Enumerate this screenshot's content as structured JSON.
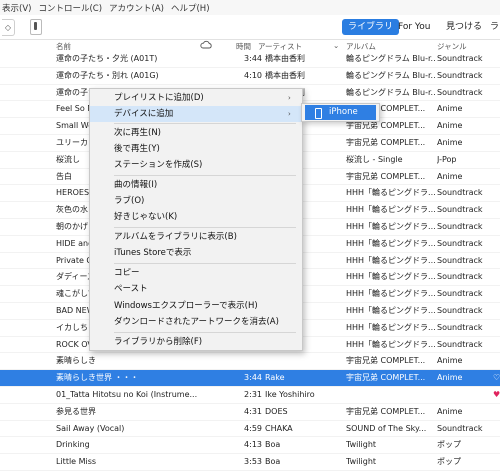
{
  "menubar": [
    "表示(V)",
    "コントロール(C)",
    "アカウント(A)",
    "ヘルプ(H)"
  ],
  "toolbar": {
    "nav_arrow": "◇",
    "tabs": [
      "ライブラリ",
      "For You",
      "見つける",
      "ラ"
    ]
  },
  "columns": {
    "name": "名前",
    "time": "時間",
    "artist": "アーティスト",
    "album": "アルバム",
    "genre": "ジャンル"
  },
  "rows": [
    {
      "name": "運命の子たち・夕光 (A01T)",
      "time": "3:44",
      "artist": "橋本由香利",
      "album": "輪るピングドラム Blu-r...",
      "genre": "Soundtrack"
    },
    {
      "name": "運命の子たち・別れ (A01G)",
      "time": "4:10",
      "artist": "橋本由香利",
      "album": "輪るピングドラム Blu-r...",
      "genre": "Soundtrack"
    },
    {
      "name": "運命の子たち",
      "time": "3:40",
      "artist": "橋本由香利",
      "album": "輪るピングドラム Blu-r...",
      "genre": "Soundtrack"
    },
    {
      "name": "Feel So M",
      "time": "",
      "artist": "",
      "album": "宇宙兄弟 COMPLET...",
      "genre": "Anime"
    },
    {
      "name": "Small Wo",
      "time": "",
      "artist": "",
      "album": "宇宙兄弟 COMPLET...",
      "genre": "Anime"
    },
    {
      "name": "ユリーカ",
      "time": "",
      "artist": "",
      "album": "宇宙兄弟 COMPLET...",
      "genre": "Anime"
    },
    {
      "name": "桜流し",
      "time": "",
      "artist": "",
      "album": "桜流し - Single",
      "genre": "J-Pop"
    },
    {
      "name": "告白",
      "time": "",
      "artist": "",
      "album": "宇宙兄弟 COMPLET...",
      "genre": "Anime"
    },
    {
      "name": "HEROES",
      "time": "",
      "artist": "",
      "album": "HHH「輪るピングドラ...",
      "genre": "Soundtrack"
    },
    {
      "name": "灰色の水",
      "time": "",
      "artist": "",
      "album": "HHH「輪るピングドラ...",
      "genre": "Soundtrack"
    },
    {
      "name": "朝のかげり",
      "time": "",
      "artist": "",
      "album": "HHH「輪るピングドラ...",
      "genre": "Soundtrack"
    },
    {
      "name": "HIDE and",
      "time": "",
      "artist": "",
      "album": "HHH「輪るピングドラ...",
      "genre": "Soundtrack"
    },
    {
      "name": "Private G",
      "time": "",
      "artist": "",
      "album": "HHH「輪るピングドラ...",
      "genre": "Soundtrack"
    },
    {
      "name": "ダディーズ",
      "time": "",
      "artist": "",
      "album": "HHH「輪るピングドラ...",
      "genre": "Soundtrack"
    },
    {
      "name": "魂こがして",
      "time": "",
      "artist": "",
      "album": "HHH「輪るピングドラ...",
      "genre": "Soundtrack"
    },
    {
      "name": "BAD NEW",
      "time": "",
      "artist": "",
      "album": "HHH「輪るピングドラ...",
      "genre": "Soundtrack"
    },
    {
      "name": "イカしちま",
      "time": "",
      "artist": "",
      "album": "HHH「輪るピングドラ...",
      "genre": "Soundtrack"
    },
    {
      "name": "ROCK OV",
      "time": "",
      "artist": "",
      "album": "HHH「輪るピングドラ...",
      "genre": "Soundtrack"
    },
    {
      "name": "素晴らしき",
      "time": "",
      "artist": "",
      "album": "宇宙兄弟 COMPLET...",
      "genre": "Anime"
    },
    {
      "name": "素晴らしき世界 ・・・",
      "time": "3:44",
      "artist": "Rake",
      "album": "宇宙兄弟 COMPLET...",
      "genre": "Anime",
      "selected": true,
      "heart": "♡"
    },
    {
      "name": "01_Tatta Hitotsu no Koi (Instrume...",
      "time": "2:31",
      "artist": "Ike Yoshihiro",
      "album": "",
      "genre": "",
      "heart": "♥"
    },
    {
      "name": "参見る世界",
      "time": "4:31",
      "artist": "DOES",
      "album": "宇宙兄弟 COMPLET...",
      "genre": "Anime"
    },
    {
      "name": "Sail Away (Vocal)",
      "time": "4:59",
      "artist": "CHAKA",
      "album": "SOUND of The Sky...",
      "genre": "Soundtrack"
    },
    {
      "name": "Drinking",
      "time": "4:13",
      "artist": "Boa",
      "album": "Twilight",
      "genre": "ポップ"
    },
    {
      "name": "Little Miss",
      "time": "3:53",
      "artist": "Boa",
      "album": "Twilight",
      "genre": "ポップ"
    }
  ],
  "context_menu": {
    "items": [
      {
        "label": "プレイリストに追加(D)",
        "submenu": true
      },
      {
        "label": "デバイスに追加",
        "submenu": true,
        "highlighted": true
      },
      {
        "label": "次に再生(N)"
      },
      {
        "label": "後で再生(Y)"
      },
      {
        "label": "ステーションを作成(S)"
      },
      {
        "label": "曲の情報(I)"
      },
      {
        "label": "ラブ(O)"
      },
      {
        "label": "好きじゃない(K)"
      },
      {
        "label": "アルバムをライブラリに表示(B)"
      },
      {
        "label": "iTunes Storeで表示"
      },
      {
        "label": "コピー"
      },
      {
        "label": "ペースト"
      },
      {
        "label": "Windowsエクスプローラーで表示(H)"
      },
      {
        "label": "ダウンロードされたアートワークを消去(A)"
      },
      {
        "label": "ライブラリから削除(F)"
      }
    ],
    "submenu_arrow": "›",
    "device_submenu": {
      "label": "iPhone"
    }
  },
  "colors": {
    "accent": "#2a7de1",
    "selection": "#2f7fe3",
    "heart": "#e0245e"
  }
}
